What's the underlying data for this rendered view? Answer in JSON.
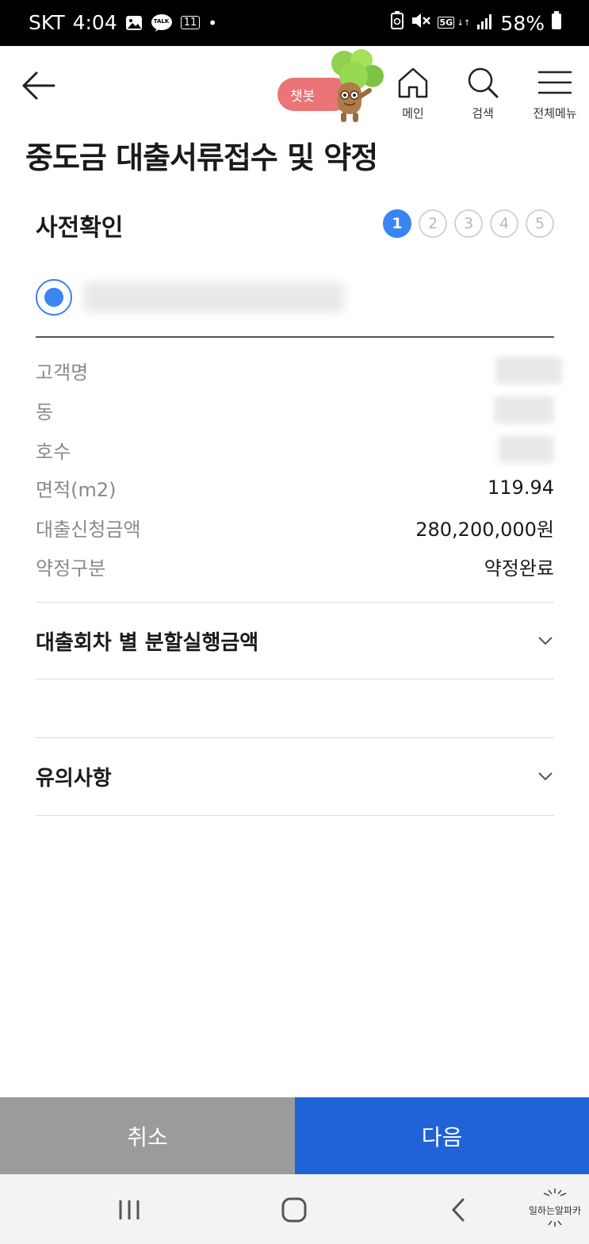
{
  "status_bar": {
    "carrier": "SKT",
    "time": "4:04",
    "talk_badge": "TALK",
    "eleven_badge": "11",
    "network": "5G",
    "battery": "58%"
  },
  "header": {
    "chatbot_label": "챗봇",
    "nav": [
      {
        "label": "메인",
        "icon": "home-icon"
      },
      {
        "label": "검색",
        "icon": "search-icon"
      },
      {
        "label": "전체메뉴",
        "icon": "menu-icon"
      }
    ]
  },
  "page": {
    "title": "중도금 대출서류접수 및 약정",
    "section_title": "사전확인",
    "steps": [
      "1",
      "2",
      "3",
      "4",
      "5"
    ],
    "active_step": 1
  },
  "info": {
    "rows": [
      {
        "key": "고객명",
        "value": ""
      },
      {
        "key": "동",
        "value": ""
      },
      {
        "key": "호수",
        "value": ""
      },
      {
        "key": "면적(m2)",
        "value": "119.94"
      },
      {
        "key": "대출신청금액",
        "value": "280,200,000원"
      },
      {
        "key": "약정구분",
        "value": "약정완료"
      }
    ]
  },
  "accordions": [
    {
      "title": "대출회차 별 분할실행금액"
    },
    {
      "title": "유의사항"
    }
  ],
  "actions": {
    "cancel": "취소",
    "next": "다음"
  },
  "colors": {
    "accent": "#3a84f3",
    "primary_button": "#1f63d6",
    "secondary_button": "#9b9b9b",
    "chatbot": "#e97576"
  },
  "watermark": "일하는알파카"
}
